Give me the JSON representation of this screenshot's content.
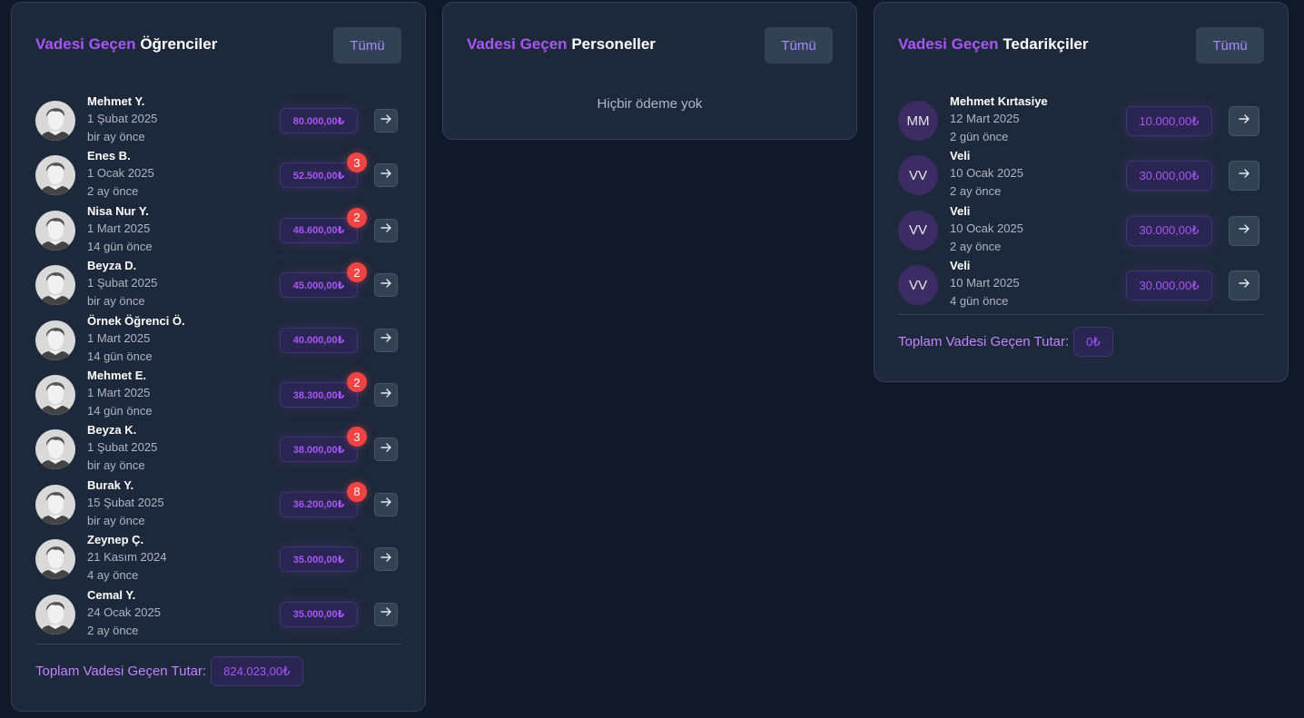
{
  "students": {
    "title_accent": "Vadesi Geçen",
    "title_rest": "Öğrenciler",
    "all_button": "Tümü",
    "items": [
      {
        "name": "Mehmet Y.",
        "date": "1 Şubat 2025",
        "ago": "bir ay önce",
        "amount": "80.000,00₺",
        "badge": ""
      },
      {
        "name": "Enes B.",
        "date": "1 Ocak 2025",
        "ago": "2 ay önce",
        "amount": "52.500,00₺",
        "badge": "3"
      },
      {
        "name": "Nisa Nur Y.",
        "date": "1 Mart 2025",
        "ago": "14 gün önce",
        "amount": "46.600,00₺",
        "badge": "2"
      },
      {
        "name": "Beyza D.",
        "date": "1 Şubat 2025",
        "ago": "bir ay önce",
        "amount": "45.000,00₺",
        "badge": "2"
      },
      {
        "name": "Örnek Öğrenci Ö.",
        "date": "1 Mart 2025",
        "ago": "14 gün önce",
        "amount": "40.000,00₺",
        "badge": ""
      },
      {
        "name": "Mehmet E.",
        "date": "1 Mart 2025",
        "ago": "14 gün önce",
        "amount": "38.300,00₺",
        "badge": "2"
      },
      {
        "name": "Beyza K.",
        "date": "1 Şubat 2025",
        "ago": "bir ay önce",
        "amount": "38.000,00₺",
        "badge": "3"
      },
      {
        "name": "Burak Y.",
        "date": "15 Şubat 2025",
        "ago": "bir ay önce",
        "amount": "36.200,00₺",
        "badge": "8"
      },
      {
        "name": "Zeynep Ç.",
        "date": "21 Kasım 2024",
        "ago": "4 ay önce",
        "amount": "35.000,00₺",
        "badge": ""
      },
      {
        "name": "Cemal Y.",
        "date": "24 Ocak 2025",
        "ago": "2 ay önce",
        "amount": "35.000,00₺",
        "badge": ""
      }
    ],
    "total_label": "Toplam Vadesi Geçen Tutar:",
    "total_value": "824.023,00₺"
  },
  "staff": {
    "title_accent": "Vadesi Geçen",
    "title_rest": "Personeller",
    "all_button": "Tümü",
    "empty_message": "Hiçbir ödeme yok"
  },
  "suppliers": {
    "title_accent": "Vadesi Geçen",
    "title_rest": "Tedarikçiler",
    "all_button": "Tümü",
    "items": [
      {
        "initials": "MM",
        "name": "Mehmet Kırtasiye",
        "date": "12 Mart 2025",
        "ago": "2 gün önce",
        "amount": "10.000,00₺"
      },
      {
        "initials": "VV",
        "name": "Veli",
        "date": "10 Ocak 2025",
        "ago": "2 ay önce",
        "amount": "30.000,00₺"
      },
      {
        "initials": "VV",
        "name": "Veli",
        "date": "10 Ocak 2025",
        "ago": "2 ay önce",
        "amount": "30.000,00₺"
      },
      {
        "initials": "VV",
        "name": "Veli",
        "date": "10 Mart 2025",
        "ago": "4 gün önce",
        "amount": "30.000,00₺"
      }
    ],
    "total_label": "Toplam Vadesi Geçen Tutar:",
    "total_value": "0₺"
  },
  "colors": {
    "background": "#101829",
    "card": "#1e283b",
    "accent": "#a855f7",
    "badge": "#ef4444"
  },
  "icons": {
    "avatar": "default-user-avatar-icon",
    "arrow": "arrow-right-icon"
  }
}
